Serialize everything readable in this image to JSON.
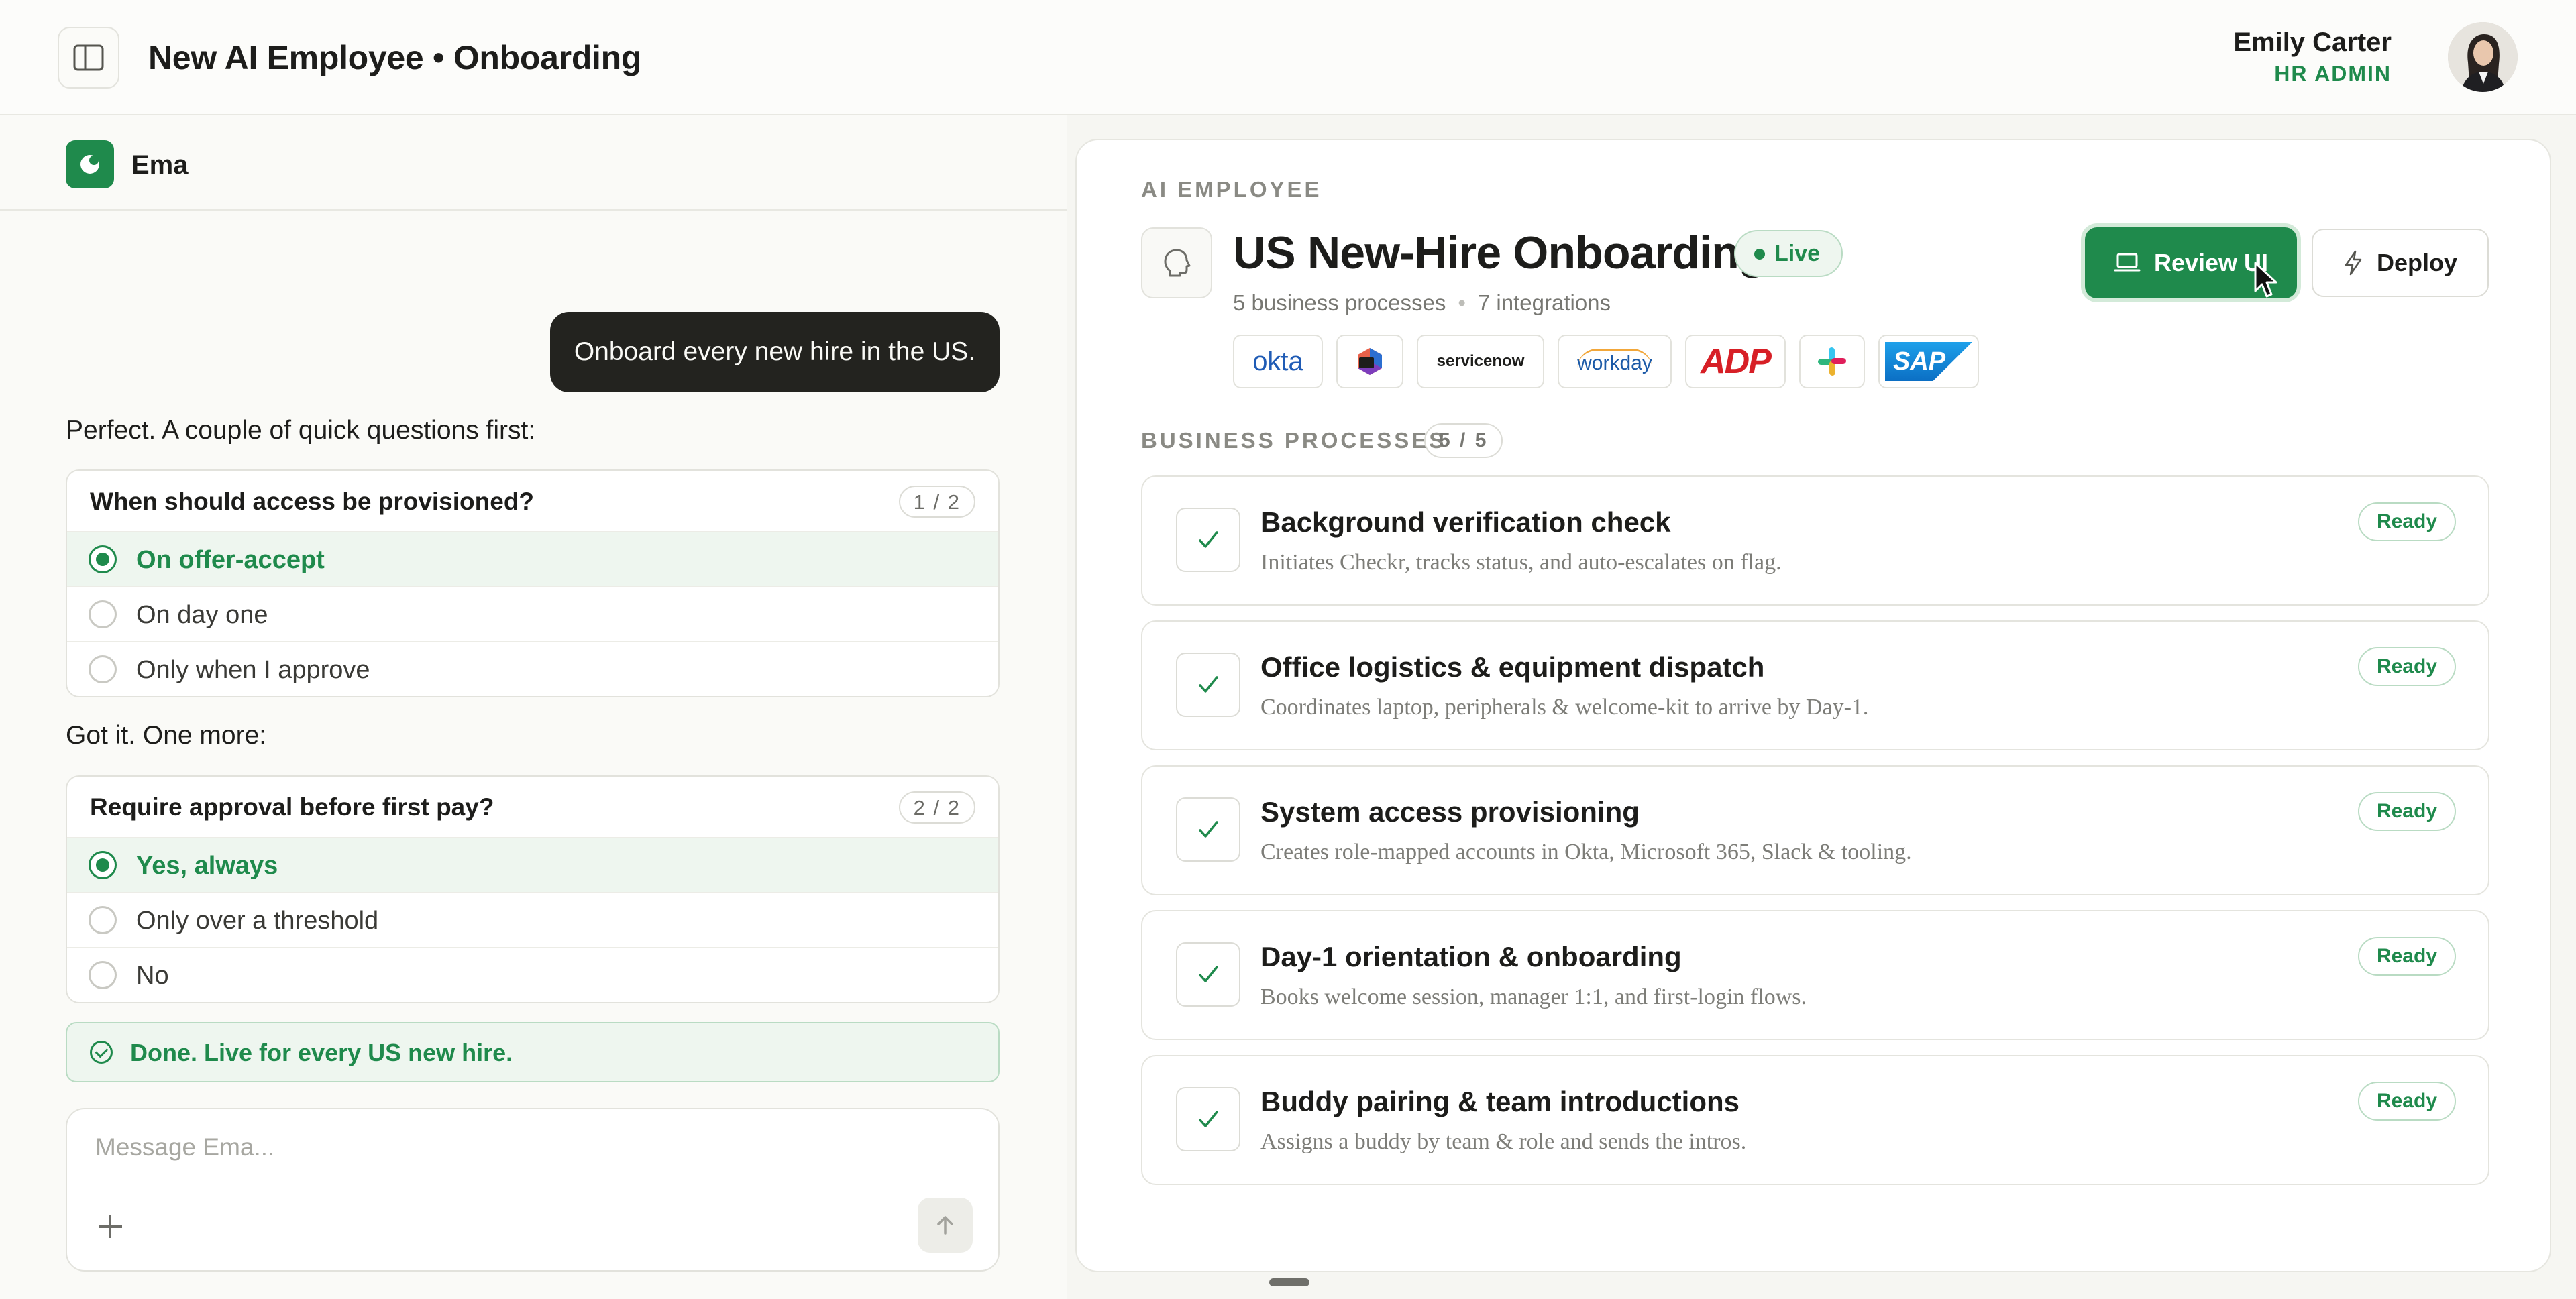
{
  "header": {
    "title": "New AI Employee • Onboarding",
    "user_name": "Emily Carter",
    "user_role": "HR ADMIN"
  },
  "chat": {
    "agent_name": "Ema",
    "user_message": "Onboard every new hire in the US.",
    "intro_text": "Perfect. A couple of quick questions first:",
    "questions": [
      {
        "title": "When should access be provisioned?",
        "count": "1 / 2",
        "options": [
          {
            "label": "On offer-accept",
            "selected": true
          },
          {
            "label": "On day one",
            "selected": false
          },
          {
            "label": "Only when I approve",
            "selected": false
          }
        ]
      },
      {
        "title": "Require approval before first pay?",
        "count": "2 / 2",
        "options": [
          {
            "label": "Yes, always",
            "selected": true
          },
          {
            "label": "Only over a threshold",
            "selected": false
          },
          {
            "label": "No",
            "selected": false
          }
        ]
      }
    ],
    "followup_text": "Got it. One more:",
    "done_text": "Done. Live for every US new hire.",
    "composer_placeholder": "Message Ema..."
  },
  "employee": {
    "section_label": "AI EMPLOYEE",
    "name": "US New-Hire Onboarding",
    "status": "Live",
    "processes_meta": "5 business processes",
    "integrations_meta": "7 integrations",
    "integrations": [
      "okta",
      "Microsoft 365",
      "servicenow",
      "workday",
      "ADP",
      "slack",
      "SAP"
    ],
    "review_label": "Review UI",
    "deploy_label": "Deploy"
  },
  "processes": {
    "section_label": "BUSINESS PROCESSES",
    "count": "5 / 5",
    "items": [
      {
        "title": "Background verification check",
        "desc": "Initiates Checkr, tracks status, and auto-escalates on flag.",
        "status": "Ready"
      },
      {
        "title": "Office logistics & equipment dispatch",
        "desc": "Coordinates laptop, peripherals & welcome-kit to arrive by Day-1.",
        "status": "Ready"
      },
      {
        "title": "System access provisioning",
        "desc": "Creates role-mapped accounts in Okta, Microsoft 365, Slack & tooling.",
        "status": "Ready"
      },
      {
        "title": "Day-1 orientation & onboarding",
        "desc": "Books welcome session, manager 1:1, and first-login flows.",
        "status": "Ready"
      },
      {
        "title": "Buddy pairing & team introductions",
        "desc": "Assigns a buddy by team & role and sends the intros.",
        "status": "Ready"
      }
    ]
  },
  "colors": {
    "accent": "#1f8a4c",
    "background": "#f6f6f2",
    "bubble": "#23231f"
  }
}
